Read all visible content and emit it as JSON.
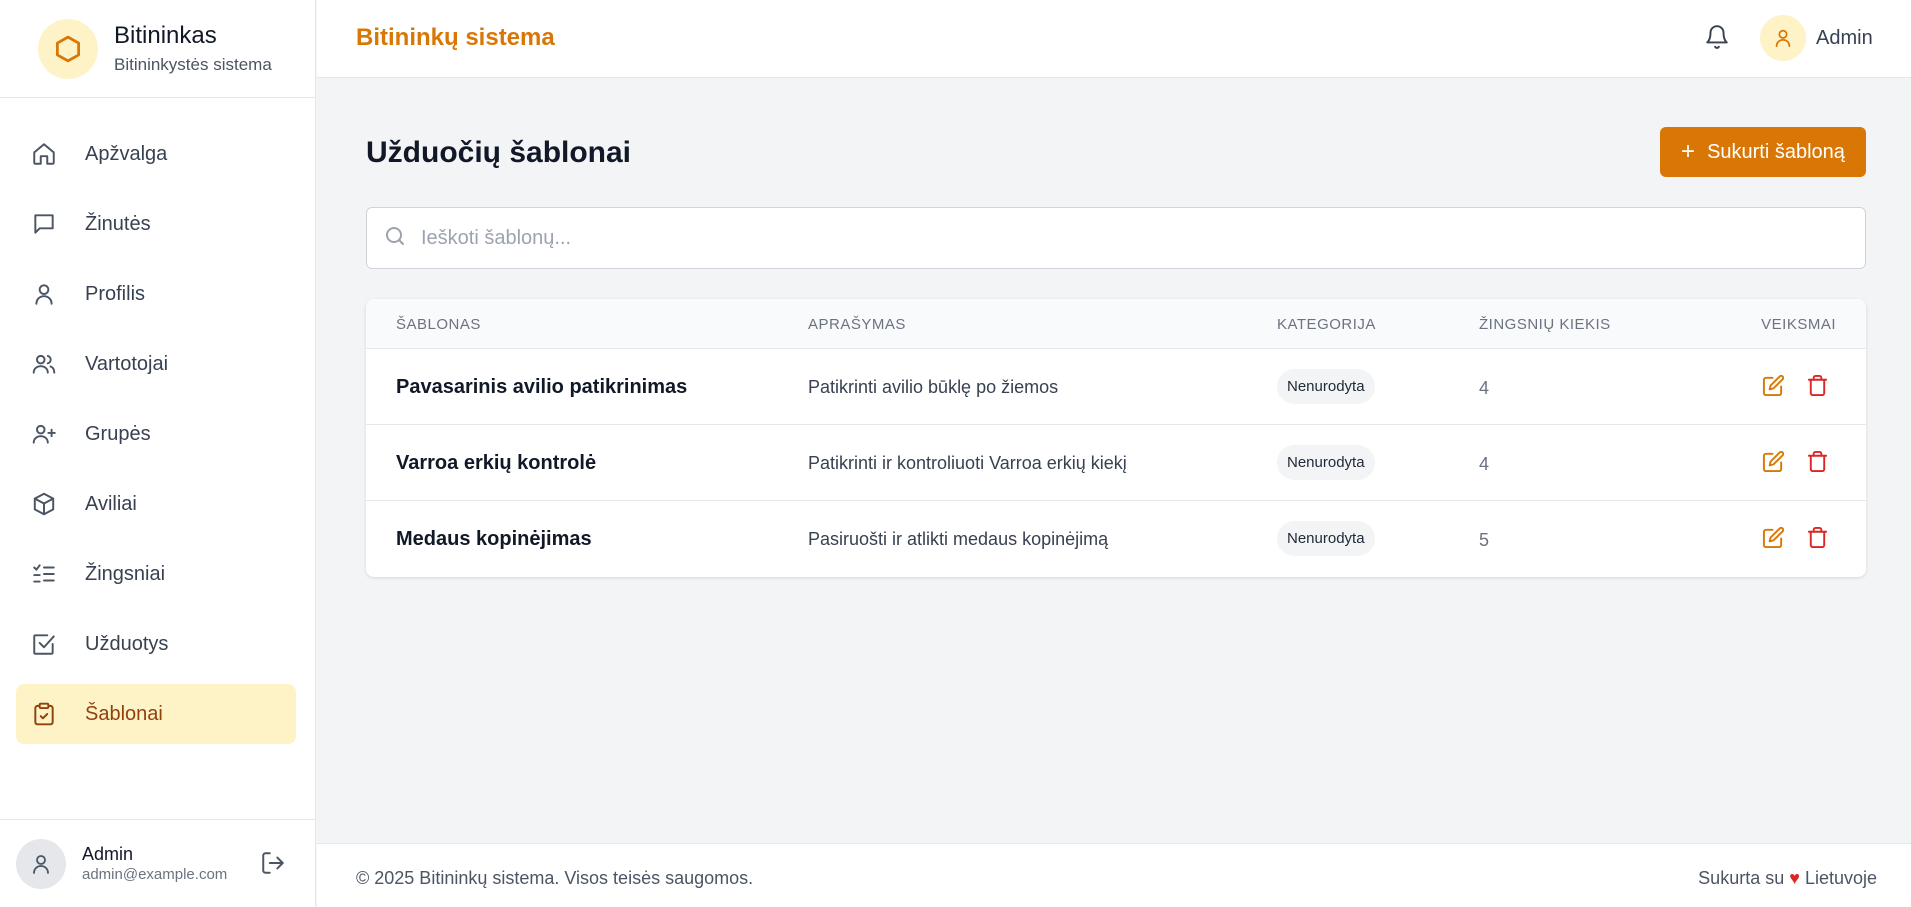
{
  "brand": {
    "title": "Bitininkas",
    "subtitle": "Bitininkystės sistema",
    "logo_icon": "hexagon-icon"
  },
  "sidebar": {
    "items": [
      {
        "label": "Apžvalga",
        "icon": "home-icon",
        "active": false
      },
      {
        "label": "Žinutės",
        "icon": "message-icon",
        "active": false
      },
      {
        "label": "Profilis",
        "icon": "user-icon",
        "active": false
      },
      {
        "label": "Vartotojai",
        "icon": "users-icon",
        "active": false
      },
      {
        "label": "Grupės",
        "icon": "user-plus-icon",
        "active": false
      },
      {
        "label": "Aviliai",
        "icon": "box-icon",
        "active": false
      },
      {
        "label": "Žingsniai",
        "icon": "list-checks-icon",
        "active": false
      },
      {
        "label": "Užduotys",
        "icon": "check-square-icon",
        "active": false
      },
      {
        "label": "Šablonai",
        "icon": "clipboard-check-icon",
        "active": true
      }
    ],
    "user": {
      "name": "Admin",
      "email": "admin@example.com"
    }
  },
  "header": {
    "title": "Bitininkų sistema",
    "user_name": "Admin"
  },
  "main": {
    "title": "Užduočių šablonai",
    "create_button": "Sukurti šabloną",
    "search_placeholder": "Ieškoti šablonų...",
    "table": {
      "columns": [
        "ŠABLONAS",
        "APRAŠYMAS",
        "KATEGORIJA",
        "ŽINGSNIŲ KIEKIS",
        "VEIKSMAI"
      ],
      "rows": [
        {
          "name": "Pavasarinis avilio patikrinimas",
          "description": "Patikrinti avilio būklę po žiemos",
          "category": "Nenurodyta",
          "steps": "4"
        },
        {
          "name": "Varroa erkių kontrolė",
          "description": "Patikrinti ir kontroliuoti Varroa erkių kiekį",
          "category": "Nenurodyta",
          "steps": "4"
        },
        {
          "name": "Medaus kopinėjimas",
          "description": "Pasiruošti ir atlikti medaus kopinėjimą",
          "category": "Nenurodyta",
          "steps": "5"
        }
      ]
    }
  },
  "footer": {
    "copyright": "© 2025 Bitininkų sistema. Visos teisės saugomos.",
    "made_prefix": "Sukurta su",
    "heart": "♥",
    "made_suffix": "Lietuvoje"
  },
  "colors": {
    "accent": "#d97706",
    "active_bg": "#fef3c7",
    "active_text": "#92400e",
    "delete": "#dc2626"
  }
}
